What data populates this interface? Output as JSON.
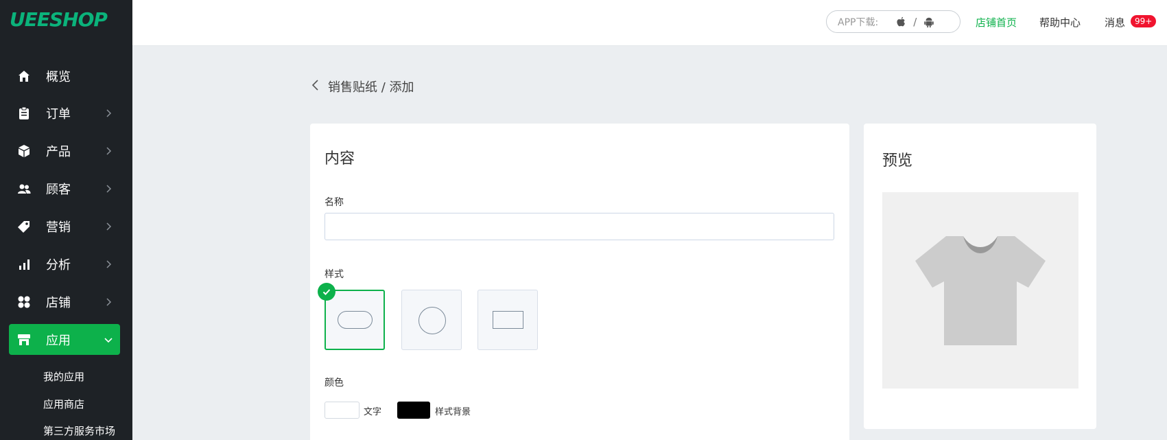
{
  "sidebar": {
    "logo": "UEESHOP",
    "items": [
      {
        "label": "概览",
        "icon": "home-icon"
      },
      {
        "label": "订单",
        "icon": "clipboard-icon"
      },
      {
        "label": "产品",
        "icon": "box-icon"
      },
      {
        "label": "顾客",
        "icon": "users-icon"
      },
      {
        "label": "营销",
        "icon": "tag-icon"
      },
      {
        "label": "分析",
        "icon": "bar-chart-icon"
      },
      {
        "label": "店铺",
        "icon": "grid-icon"
      },
      {
        "label": "应用",
        "icon": "store-icon"
      }
    ],
    "sub_items": [
      "我的应用",
      "应用商店",
      "第三方服务市场"
    ],
    "active_color": "#0db14b"
  },
  "header": {
    "app_download": "APP下载:",
    "sep": "/",
    "store_home": "店铺首页",
    "help_center": "帮助中心",
    "messages": "消息",
    "messages_badge": "99+"
  },
  "breadcrumb": "销售贴纸 / 添加",
  "content": {
    "title": "内容",
    "name_label": "名称",
    "name_value": "",
    "style_label": "样式",
    "styles": [
      "pill-shape",
      "circle-shape",
      "rectangle-shape"
    ],
    "color_label": "颜色",
    "text_color_label": "文字",
    "bg_color_label": "样式背景",
    "text_color": "#ffffff",
    "bg_color": "#000000"
  },
  "preview": {
    "title": "预览",
    "image": "tshirt-icon"
  }
}
